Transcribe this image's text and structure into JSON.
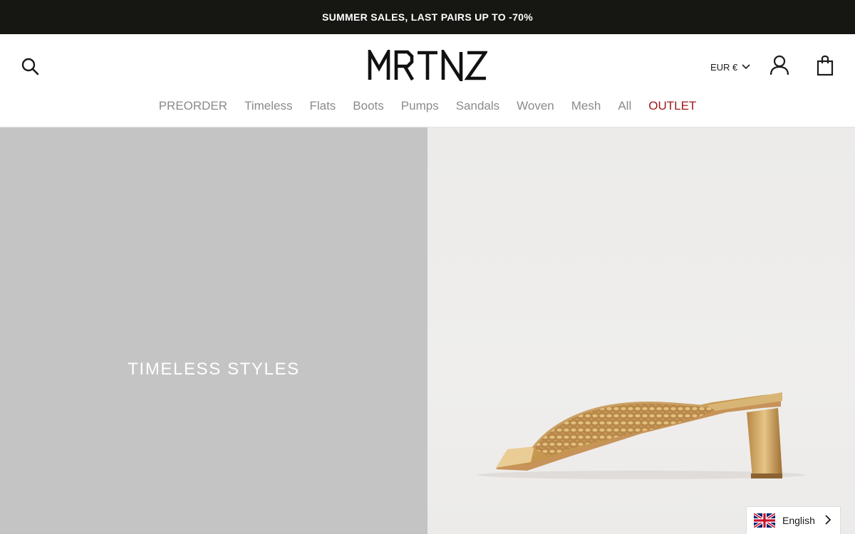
{
  "announcement": {
    "text": "SUMMER SALES, LAST PAIRS UP TO -70%"
  },
  "header": {
    "logo_text": "MRTNZ",
    "currency_label": "EUR €",
    "icons": {
      "search": "search-icon",
      "account": "user-icon",
      "cart": "shopping-bag-icon",
      "currency_chevron": "chevron-down-icon"
    }
  },
  "nav": {
    "items": [
      {
        "label": "PREORDER"
      },
      {
        "label": "Timeless"
      },
      {
        "label": "Flats"
      },
      {
        "label": "Boots"
      },
      {
        "label": "Pumps"
      },
      {
        "label": "Sandals"
      },
      {
        "label": "Woven"
      },
      {
        "label": "Mesh"
      },
      {
        "label": "All"
      },
      {
        "label": "OUTLET"
      }
    ],
    "colors": {
      "default": "#8a8a8a",
      "outlet": "#a01818"
    }
  },
  "hero": {
    "title": "TIMELESS STYLES",
    "left_bg": "#c4c4c4"
  },
  "language": {
    "label": "English",
    "flag": "uk-flag-icon"
  },
  "colors": {
    "announcement_bg": "#161613",
    "accent_outlet": "#a01818"
  }
}
